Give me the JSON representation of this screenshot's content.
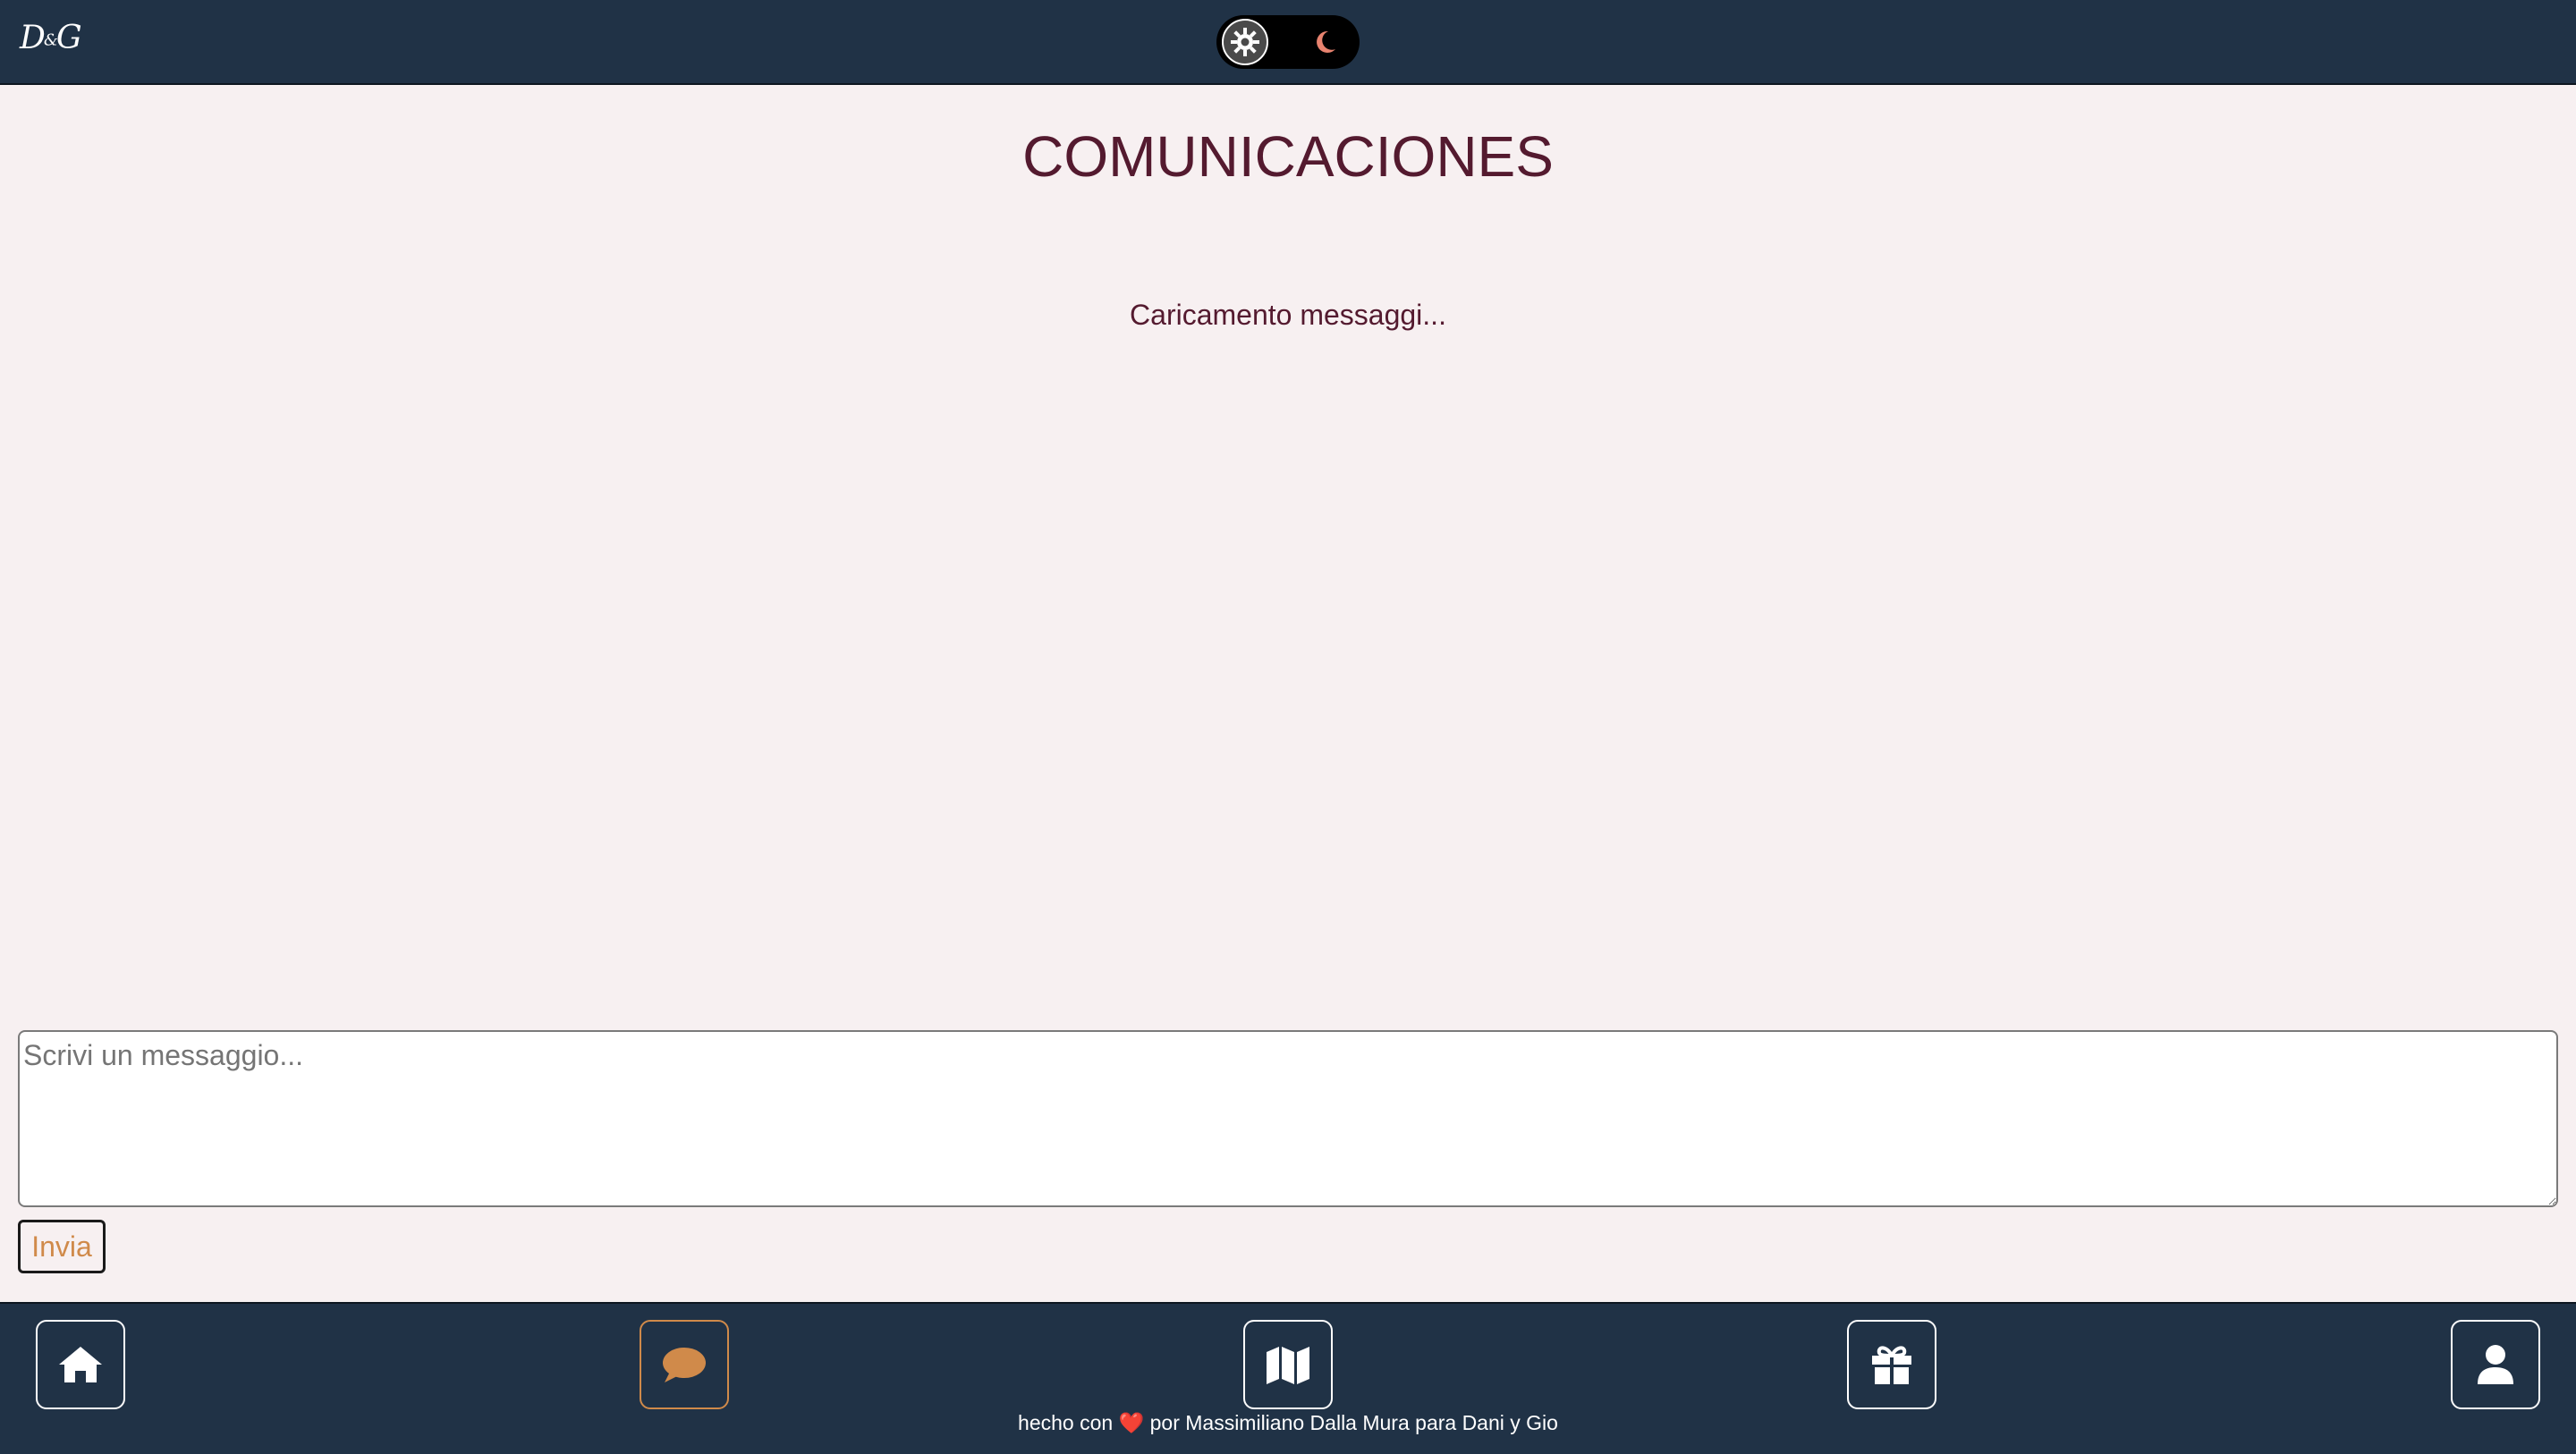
{
  "header": {
    "logo_text": "D&G",
    "theme_toggle": {
      "selected": "light",
      "options": [
        "light",
        "dark"
      ],
      "light_icon": "sun-gear-icon",
      "dark_icon": "moon-icon"
    }
  },
  "main": {
    "title": "COMUNICACIONES",
    "status_text": "Caricamento messaggi...",
    "composer": {
      "placeholder": "Scrivi un messaggio...",
      "value": "",
      "send_label": "Invia"
    }
  },
  "nav": {
    "items": [
      {
        "icon": "home-icon",
        "active": false
      },
      {
        "icon": "chat-bubble-icon",
        "active": true
      },
      {
        "icon": "map-icon",
        "active": false
      },
      {
        "icon": "gift-icon",
        "active": false
      },
      {
        "icon": "user-icon",
        "active": false
      }
    ]
  },
  "footer": {
    "credit_before": "hecho con",
    "credit_heart": "❤️",
    "credit_after": "por Massimiliano Dalla Mura para Dani y Gio"
  },
  "colors": {
    "bar_bg": "#203246",
    "page_bg": "#f7f0f1",
    "title_color": "#541a2f",
    "accent": "#d08a4a"
  }
}
